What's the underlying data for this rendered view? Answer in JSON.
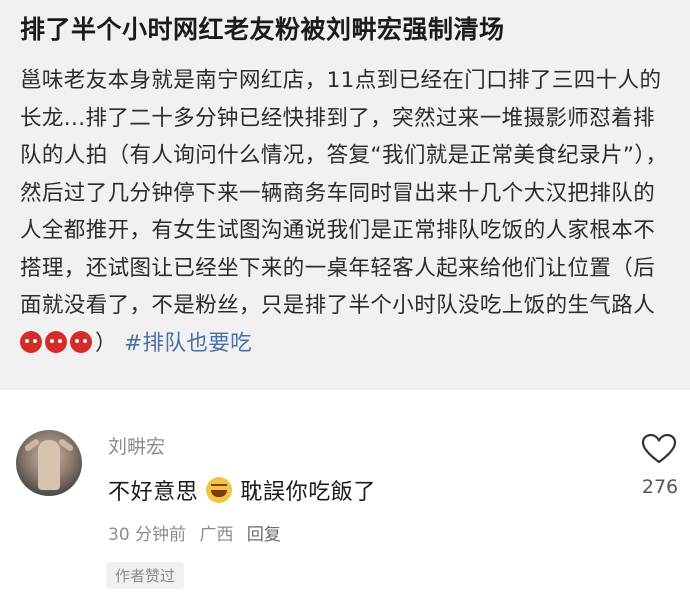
{
  "post": {
    "title": "排了半个小时网红老友粉被刘畊宏强制清场",
    "body": "邕味老友本身就是南宁网红店，11点到已经在门口排了三四十人的长龙...排了二十多分钟已经快排到了，突然过来一堆摄影师怼着排队的人拍（有人询问什么情况，答复“我们就是正常美食纪录片”），然后过了几分钟停下来一辆商务车同时冒出来十几个大汉把排队的人全都推开，有女生试图沟通说我们是正常排队吃饭的人家根本不搭理，还试图让已经坐下来的一桌年轻客人起来给他们让位置（后面就没看了，不是粉丝，只是排了半个小时队没吃上饭的生气路人",
    "hashtag": "#排队也要吃",
    "emojis": [
      "angry-devil-icon",
      "angry-devil-icon",
      "angry-devil-icon"
    ],
    "closing_paren": "）"
  },
  "comment": {
    "username": "刘畊宏",
    "text_part1": "不好意思",
    "emoji": "laughing-sweat-icon",
    "text_part2": "耽誤你吃飯了",
    "time": "30 分钟前",
    "location": "广西",
    "reply_label": "回复",
    "author_liked": "作者赞过",
    "like_count": "276"
  },
  "colors": {
    "post_background": "#f1f1f1",
    "hashtag": "#4a6fa5",
    "meta_gray": "#8c8c8c"
  }
}
